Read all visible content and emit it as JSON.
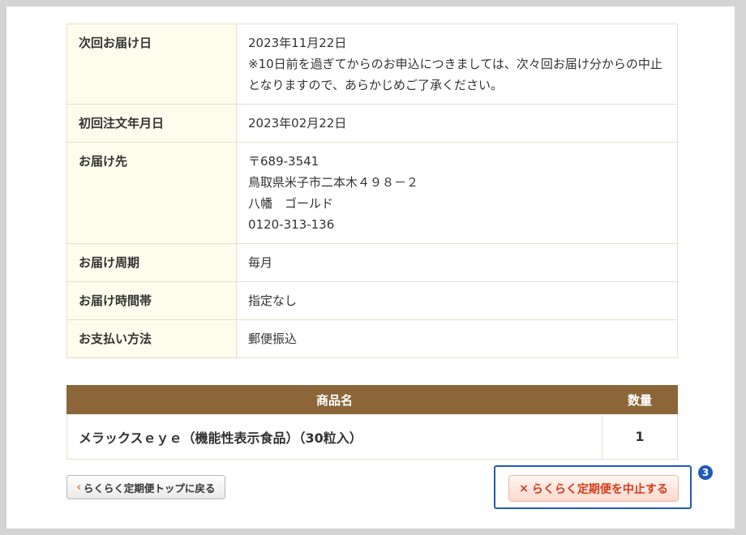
{
  "details": [
    {
      "label": "次回お届け日",
      "lines": [
        "2023年11月22日",
        "※10日前を過ぎてからのお申込につきましては、次々回お届け分からの中止",
        "となりますので、あらかじめご了承ください。"
      ]
    },
    {
      "label": "初回注文年月日",
      "lines": [
        "2023年02月22日"
      ]
    },
    {
      "label": "お届け先",
      "lines": [
        "〒689-3541",
        "鳥取県米子市二本木４９８－２",
        "八幡　ゴールド",
        "0120-313-136"
      ]
    },
    {
      "label": "お届け周期",
      "lines": [
        "毎月"
      ]
    },
    {
      "label": "お届け時間帯",
      "lines": [
        "指定なし"
      ]
    },
    {
      "label": "お支払い方法",
      "lines": [
        "郵便振込"
      ]
    }
  ],
  "products": {
    "headers": {
      "name": "商品名",
      "qty": "数量"
    },
    "rows": [
      {
        "name": "メラックスｅｙｅ（機能性表示食品）（30粒入）",
        "qty": "1"
      }
    ]
  },
  "buttons": {
    "back_label": "らくらく定期便トップに戻る",
    "back_icon": "chevron-left-icon",
    "cancel_label": "らくらく定期便を中止する",
    "cancel_icon": "x-icon"
  },
  "annotation": {
    "badge": "3",
    "color": "#1f5bb8"
  },
  "colors": {
    "header_bg": "#8c6638",
    "label_bg": "#fefcec",
    "cancel_text": "#d43c1e",
    "back_chevron": "#e0701a"
  }
}
